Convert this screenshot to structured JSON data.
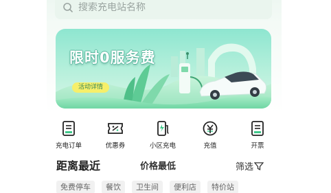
{
  "search": {
    "placeholder": "搜索充电站名称"
  },
  "banner": {
    "title": "限时0服务费",
    "cta": "活动详情"
  },
  "actions": [
    {
      "label": "充电订单",
      "icon": "order-icon"
    },
    {
      "label": "优惠券",
      "icon": "coupon-icon"
    },
    {
      "label": "小区充电",
      "icon": "charging-pile-icon"
    },
    {
      "label": "充值",
      "icon": "yuan-icon"
    },
    {
      "label": "开票",
      "icon": "invoice-icon"
    }
  ],
  "sort": {
    "distance": "距离最近",
    "price": "价格最低",
    "filter": "筛选"
  },
  "tags": [
    "免费停车",
    "餐饮",
    "卫生间",
    "便利店",
    "特价站"
  ],
  "colors": {
    "brand": "#3fc88a",
    "banner_bg": "#8ee6d0",
    "cta_bg": "#f6ef6a"
  }
}
